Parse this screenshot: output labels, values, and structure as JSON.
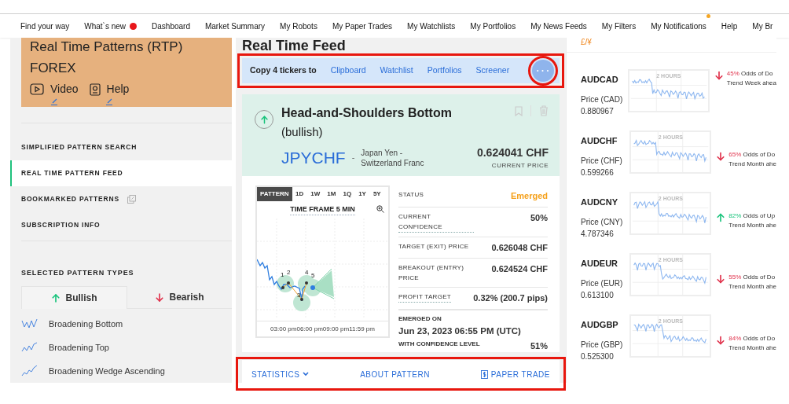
{
  "nav": {
    "items": [
      {
        "label": "Find your way"
      },
      {
        "label": "What`s new",
        "badge": {
          "kind": "inline",
          "color": "#e8161b"
        }
      },
      {
        "label": "Dashboard"
      },
      {
        "label": "Market Summary"
      },
      {
        "label": "My Robots"
      },
      {
        "label": "My Paper Trades"
      },
      {
        "label": "My Watchlists"
      },
      {
        "label": "My Portfolios"
      },
      {
        "label": "My News Feeds"
      },
      {
        "label": "My Filters"
      },
      {
        "label": "My Notifications",
        "badge": {
          "kind": "corner",
          "color": "#f5a623"
        }
      },
      {
        "label": "Help"
      },
      {
        "label": "My Br"
      }
    ]
  },
  "sidebar": {
    "card": {
      "title": "Real Time Patterns (RTP)",
      "subtitle": "FOREX",
      "links": [
        {
          "label": "Video",
          "kind": "video"
        },
        {
          "label": "Help",
          "kind": "help"
        }
      ]
    },
    "menu": [
      {
        "label": "SIMPLIFIED PATTERN SEARCH",
        "selected": false,
        "external": false
      },
      {
        "label": "REAL TIME PATTERN FEED",
        "selected": true,
        "external": false
      },
      {
        "label": "BOOKMARKED PATTERNS",
        "selected": false,
        "external": true
      },
      {
        "label": "SUBSCRIPTION INFO",
        "selected": false,
        "external": false
      }
    ],
    "section_title": "SELECTED PATTERN TYPES",
    "tabs": [
      {
        "label": "Bullish",
        "kind": "up",
        "selected": true
      },
      {
        "label": "Bearish",
        "kind": "down",
        "selected": false
      }
    ],
    "patterns": [
      {
        "label": "Broadening Bottom"
      },
      {
        "label": "Broadening Top"
      },
      {
        "label": "Broadening Wedge Ascending"
      }
    ]
  },
  "feed": {
    "title": "Real Time Feed",
    "copy_bar": {
      "label": "Copy 4 tickers to",
      "actions": [
        "Clipboard",
        "Watchlist",
        "Portfolios",
        "Screener"
      ],
      "more": "• • •"
    },
    "card": {
      "title": "Head-and-Shoulders Bottom",
      "qualifier": "(bullish)",
      "kind": "up",
      "symbol": "JPYCHF",
      "separator": "-",
      "name": "Japan Yen - Switzerland Franc",
      "price": "0.624041 CHF",
      "price_label": "CURRENT PRICE",
      "chart_tabs": [
        {
          "label": "PATTERN",
          "selected": true
        },
        {
          "label": "1D",
          "selected": false
        },
        {
          "label": "1W",
          "selected": false
        },
        {
          "label": "1M",
          "selected": false
        },
        {
          "label": "1Q",
          "selected": false
        },
        {
          "label": "1Y",
          "selected": false
        },
        {
          "label": "5Y",
          "selected": false
        }
      ],
      "chart_title": "TIME FRAME 5 MIN",
      "points": [
        "1",
        "2",
        "3",
        "4",
        "5"
      ],
      "x_labels": [
        "03:00 pm",
        "06:00 pm",
        "09:00 pm",
        "11:59 pm"
      ],
      "stats": [
        {
          "label": "STATUS",
          "value": "Emerged",
          "kind": "status",
          "hint": false
        },
        {
          "label": "CURRENT CONFIDENCE",
          "value": "50%",
          "kind": "plain",
          "hint": true
        },
        {
          "label": "TARGET (EXIT) PRICE",
          "value": "0.626048 CHF",
          "kind": "plain",
          "hint": false
        },
        {
          "label": "BREAKOUT (ENTRY) PRICE",
          "value": "0.624524 CHF",
          "kind": "plain",
          "hint": false
        },
        {
          "label": "PROFIT TARGET",
          "value": "0.32% (200.7 pips)",
          "kind": "plain",
          "hint": true
        }
      ],
      "emerged": {
        "label": "EMERGED ON",
        "date": "Jun 23, 2023 06:55 PM (UTC)",
        "confidence_label": "WITH CONFIDENCE LEVEL",
        "confidence": "51%"
      },
      "footer": [
        {
          "label": "STATISTICS",
          "kind": "dropdown"
        },
        {
          "label": "ABOUT PATTERN",
          "kind": "link"
        },
        {
          "label": "PAPER TRADE",
          "kind": "trade"
        }
      ]
    }
  },
  "watch": {
    "currency": "£/¥",
    "rows": [
      {
        "symbol": "AUDCAD",
        "price_label": "Price (CAD)",
        "price": "0.880967",
        "chart_label": "2 HOURS",
        "odds": "45%",
        "odds_text": "Odds of Do",
        "trend": "Trend Week ahea",
        "kind": "down"
      },
      {
        "symbol": "AUDCHF",
        "price_label": "Price (CHF)",
        "price": "0.599266",
        "chart_label": "2 HOURS",
        "odds": "65%",
        "odds_text": "Odds of Do",
        "trend": "Trend Month ahe",
        "kind": "down"
      },
      {
        "symbol": "AUDCNY",
        "price_label": "Price (CNY)",
        "price": "4.787346",
        "chart_label": "2 HOURS",
        "odds": "82%",
        "odds_text": "Odds of Up",
        "trend": "Trend Month ahe",
        "kind": "up"
      },
      {
        "symbol": "AUDEUR",
        "price_label": "Price (EUR)",
        "price": "0.613100",
        "chart_label": "2 HOURS",
        "odds": "55%",
        "odds_text": "Odds of Do",
        "trend": "Trend Month ahe",
        "kind": "down"
      },
      {
        "symbol": "AUDGBP",
        "price_label": "Price (GBP)",
        "price": "0.525300",
        "chart_label": "2 HOURS",
        "odds": "84%",
        "odds_text": "Odds of Do",
        "trend": "Trend Month ahe",
        "kind": "down"
      }
    ]
  }
}
